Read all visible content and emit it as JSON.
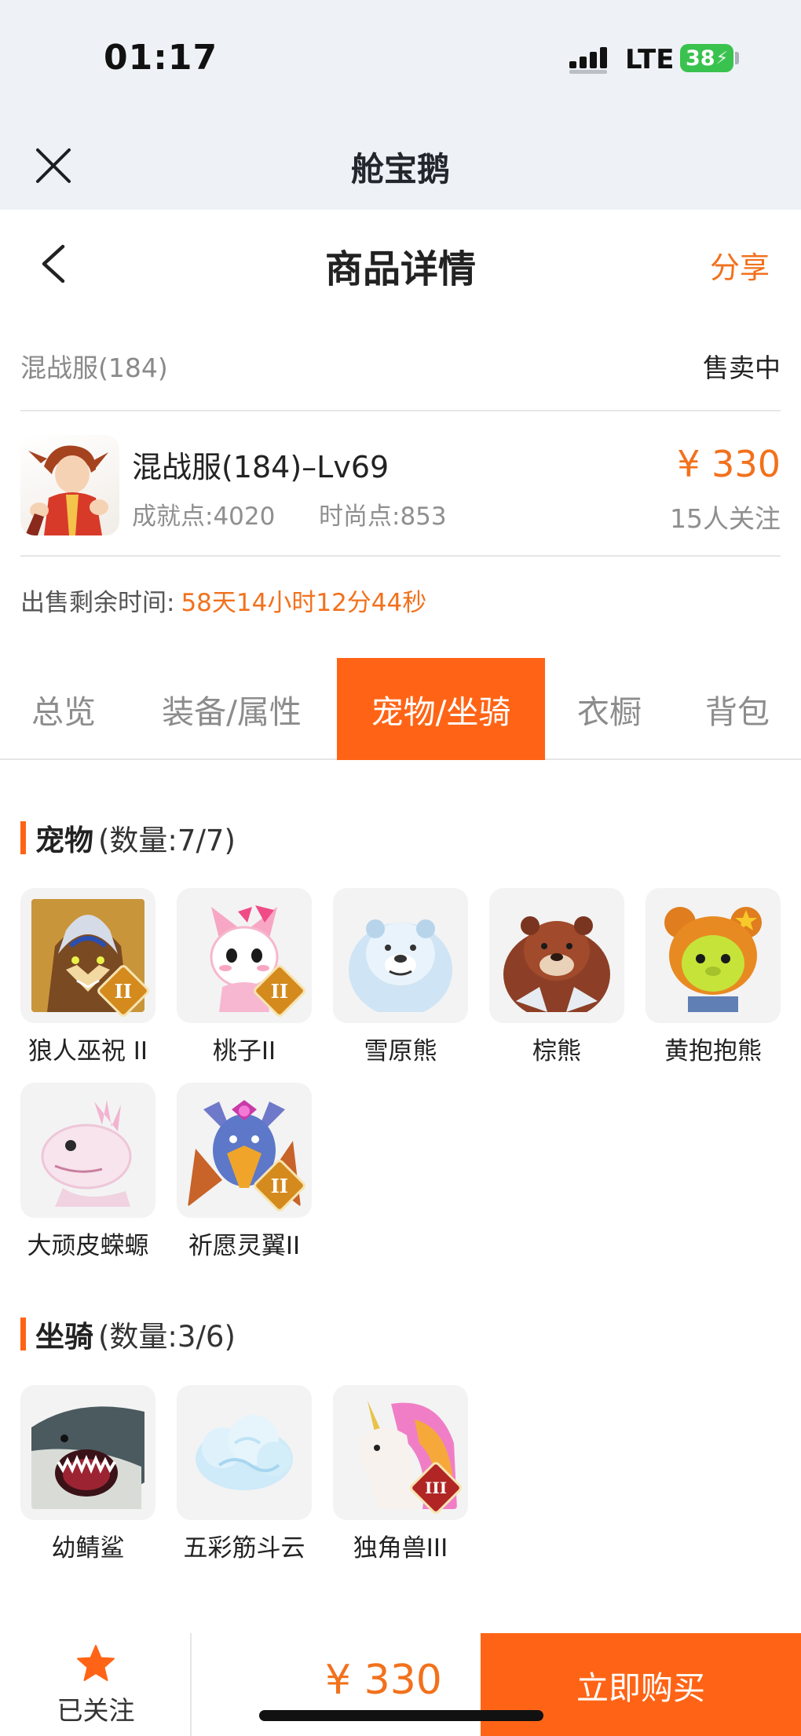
{
  "status_bar": {
    "time": "01:17",
    "network": "LTE",
    "battery": "38"
  },
  "app": {
    "title": "舱宝鹅"
  },
  "header": {
    "title": "商品详情",
    "share_label": "分享"
  },
  "listing": {
    "server": "混战服(184)",
    "status": "售卖中",
    "title": "混战服(184)–Lv69",
    "achievement": "成就点:4020",
    "fashion": "时尚点:853",
    "price": "¥ 330",
    "followers": "15人关注",
    "remaining_label": "出售剩余时间:",
    "remaining_value": "58天14小时12分44秒"
  },
  "tabs": [
    {
      "label": "总览",
      "active": false
    },
    {
      "label": "装备/属性",
      "active": false
    },
    {
      "label": "宠物/坐骑",
      "active": true
    },
    {
      "label": "衣橱",
      "active": false
    },
    {
      "label": "背包",
      "active": false
    }
  ],
  "pets": {
    "title": "宠物",
    "count": "(数量:7/7)",
    "items": [
      {
        "name": "狼人巫祝 II",
        "icon": "werewolf-shaman-icon",
        "badge": "II"
      },
      {
        "name": "桃子II",
        "icon": "pink-cat-icon",
        "badge": "II"
      },
      {
        "name": "雪原熊",
        "icon": "snow-bear-icon",
        "badge": ""
      },
      {
        "name": "棕熊",
        "icon": "brown-bear-icon",
        "badge": ""
      },
      {
        "name": "黄抱抱熊",
        "icon": "yellow-hug-bear-icon",
        "badge": ""
      },
      {
        "name": "大顽皮蝾螈",
        "icon": "axolotl-icon",
        "badge": ""
      },
      {
        "name": "祈愿灵翼II",
        "icon": "wish-bird-icon",
        "badge": "II"
      }
    ]
  },
  "mounts": {
    "title": "坐骑",
    "count": "(数量:3/6)",
    "items": [
      {
        "name": "幼鲭鲨",
        "icon": "shark-icon",
        "badge": ""
      },
      {
        "name": "五彩筋斗云",
        "icon": "cloud-icon",
        "badge": ""
      },
      {
        "name": "独角兽III",
        "icon": "unicorn-icon",
        "badge": "III"
      }
    ]
  },
  "bottom_bar": {
    "fav_label": "已关注",
    "price": "¥ 330",
    "buy_label": "立即购买"
  },
  "colors": {
    "accent": "#ff6416",
    "price": "#f2711c",
    "battery": "#3ac24f"
  }
}
